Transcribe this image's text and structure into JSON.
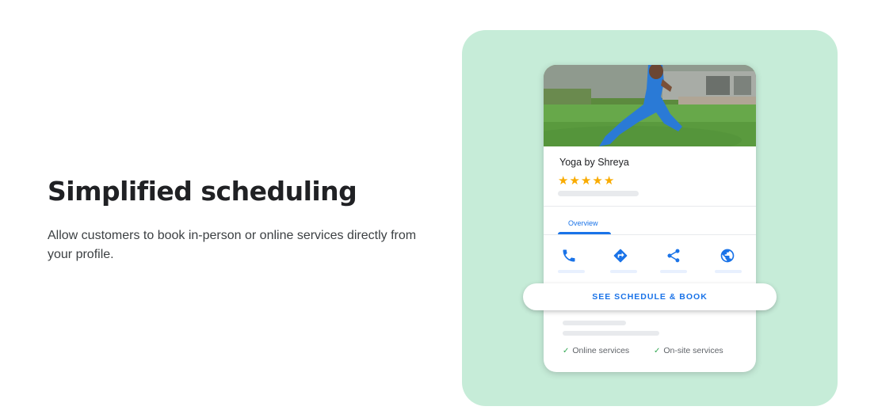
{
  "headline": "Simplified scheduling",
  "description": "Allow customers to book in-person or online services directly from your profile.",
  "colors": {
    "panel_bg": "#c6ecd8",
    "accent_blue": "#1a73e8",
    "star": "#f9ab00",
    "check_green": "#34a853"
  },
  "profile": {
    "business_name": "Yoga by Shreya",
    "rating_stars": 5,
    "tab_label": "Overview",
    "actions": [
      "phone-icon",
      "directions-icon",
      "share-icon",
      "website-globe-icon"
    ],
    "book_button_label": "SEE SCHEDULE & BOOK",
    "services": [
      "Online services",
      "On-site services"
    ]
  }
}
